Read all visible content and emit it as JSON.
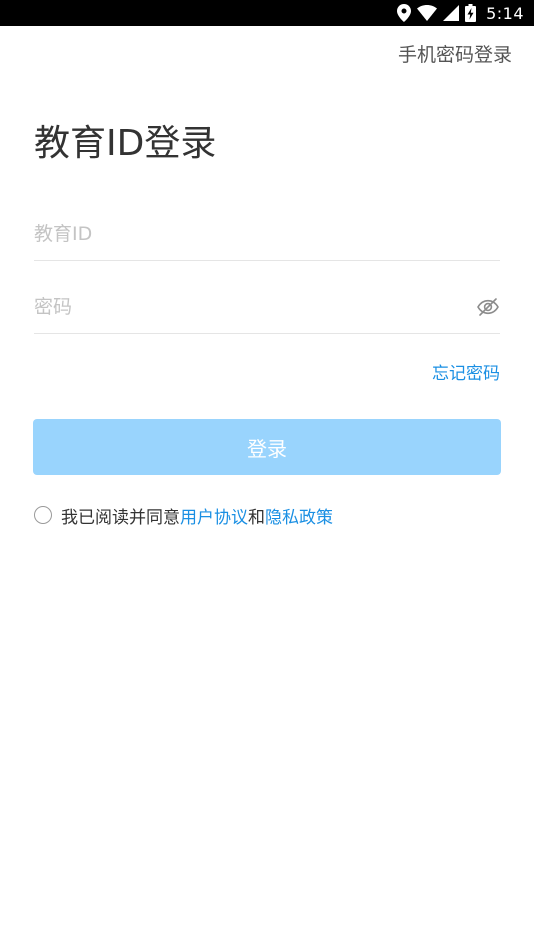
{
  "status_bar": {
    "time": "5:14",
    "icons": [
      "location-icon",
      "wifi-icon",
      "cell-signal-icon",
      "battery-charging-icon"
    ]
  },
  "header": {
    "switch_login_label": "手机密码登录"
  },
  "page": {
    "title": "教育ID登录"
  },
  "form": {
    "id_placeholder": "教育ID",
    "id_value": "",
    "password_placeholder": "密码",
    "password_value": "",
    "password_toggle_icon": "eye-off-icon",
    "forgot_password_label": "忘记密码",
    "login_label": "登录"
  },
  "agreement": {
    "prefix": "我已阅读并同意",
    "user_agreement": "用户协议",
    "conjunction": "和",
    "privacy_policy": "隐私政策",
    "checked": false
  },
  "colors": {
    "accent": "#1a8fe3",
    "button_disabled": "#99d4fd",
    "title_text": "#333333",
    "placeholder": "#c4c4c4",
    "divider": "#e5e5e5"
  }
}
